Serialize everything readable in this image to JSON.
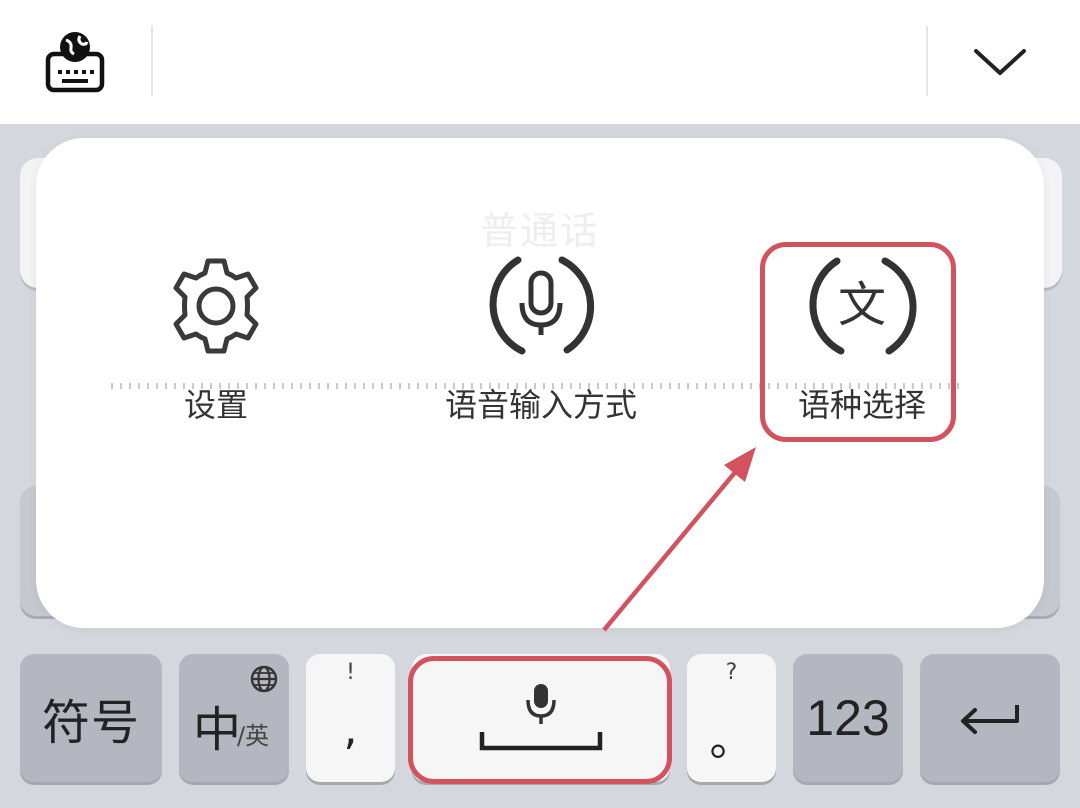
{
  "toolbar": {
    "left_icon": "keyboard-globe-icon",
    "right_icon": "chevron-down-icon"
  },
  "popup": {
    "title": "普通话",
    "options": [
      {
        "label": "设置",
        "icon": "gear-icon"
      },
      {
        "label": "语音输入方式",
        "icon": "microphone-circle-icon"
      },
      {
        "label": "语种选择",
        "icon": "language-text-icon",
        "icon_glyph": "文"
      }
    ]
  },
  "keyboard": {
    "symbol_key": "符号",
    "lang_key_main": "中",
    "lang_key_sub": "/英",
    "comma_hint": "!",
    "comma_main": ",",
    "period_hint": "?",
    "period_main": "。",
    "number_key": "123",
    "enter_icon": "enter-return-icon",
    "space_icon": "microphone-icon"
  },
  "annotation_color": "#d2525e"
}
